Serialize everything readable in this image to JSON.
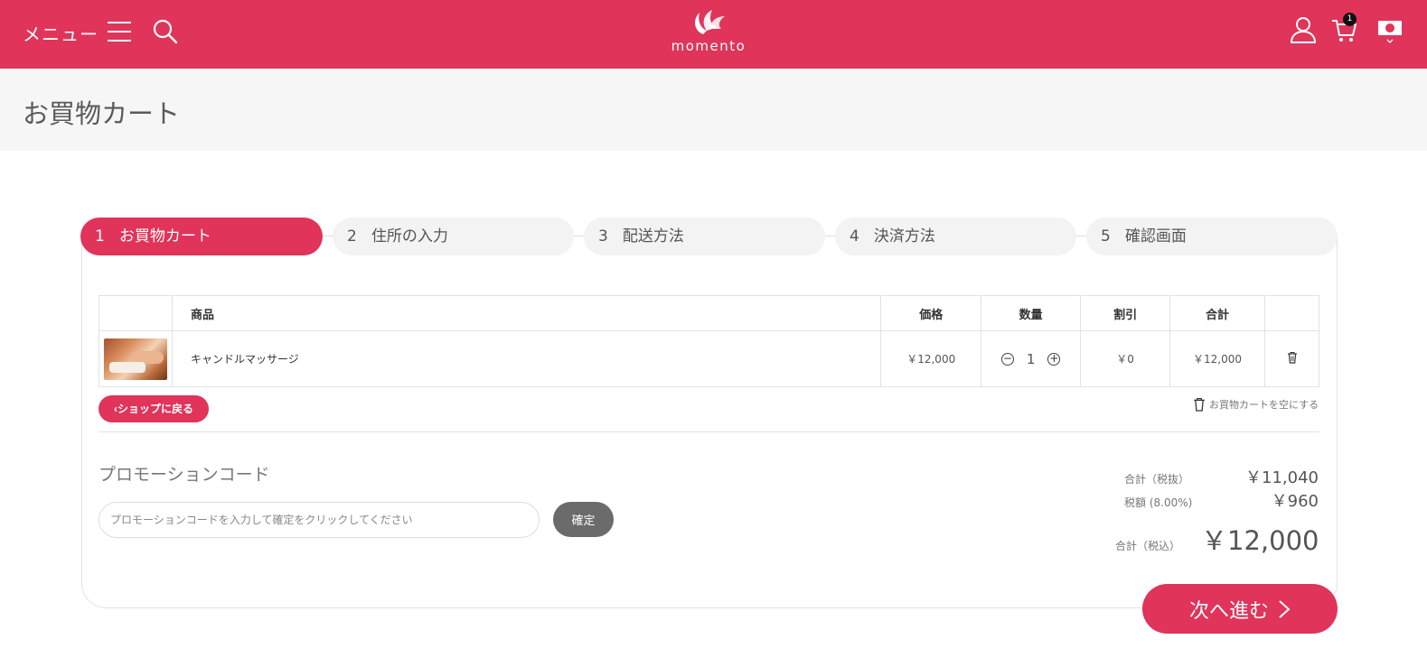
{
  "header": {
    "menu_label": "メニュー",
    "logo_text": "momento",
    "cart_count": "1"
  },
  "page": {
    "title": "お買物カート"
  },
  "steps": [
    {
      "num": "1",
      "label": "お買物カート",
      "active": true
    },
    {
      "num": "2",
      "label": "住所の入力",
      "active": false
    },
    {
      "num": "3",
      "label": "配送方法",
      "active": false
    },
    {
      "num": "4",
      "label": "決済方法",
      "active": false
    },
    {
      "num": "5",
      "label": "確認画面",
      "active": false
    }
  ],
  "table": {
    "headers": {
      "product": "商品",
      "price": "価格",
      "quantity": "数量",
      "discount": "割引",
      "total": "合計"
    },
    "rows": [
      {
        "name": "キャンドルマッサージ",
        "price": "￥12,000",
        "quantity": "1",
        "discount": "￥0",
        "total": "￥12,000"
      }
    ]
  },
  "actions": {
    "back_to_shop": "ショップに戻る",
    "empty_cart": "お買物カートを空にする",
    "next": "次へ進む"
  },
  "promo": {
    "title": "プロモーションコード",
    "placeholder": "プロモーションコードを入力して確定をクリックしてください",
    "confirm": "確定"
  },
  "summary": {
    "subtotal_label": "合計（税抜）",
    "subtotal_value": "￥11,040",
    "tax_label": "税額 (8.00%)",
    "tax_value": "￥960",
    "total_label": "合計（税込）",
    "total_value": "￥12,000"
  },
  "colors": {
    "brand": "#e0345a",
    "confirm_button": "#6b6b6b"
  }
}
